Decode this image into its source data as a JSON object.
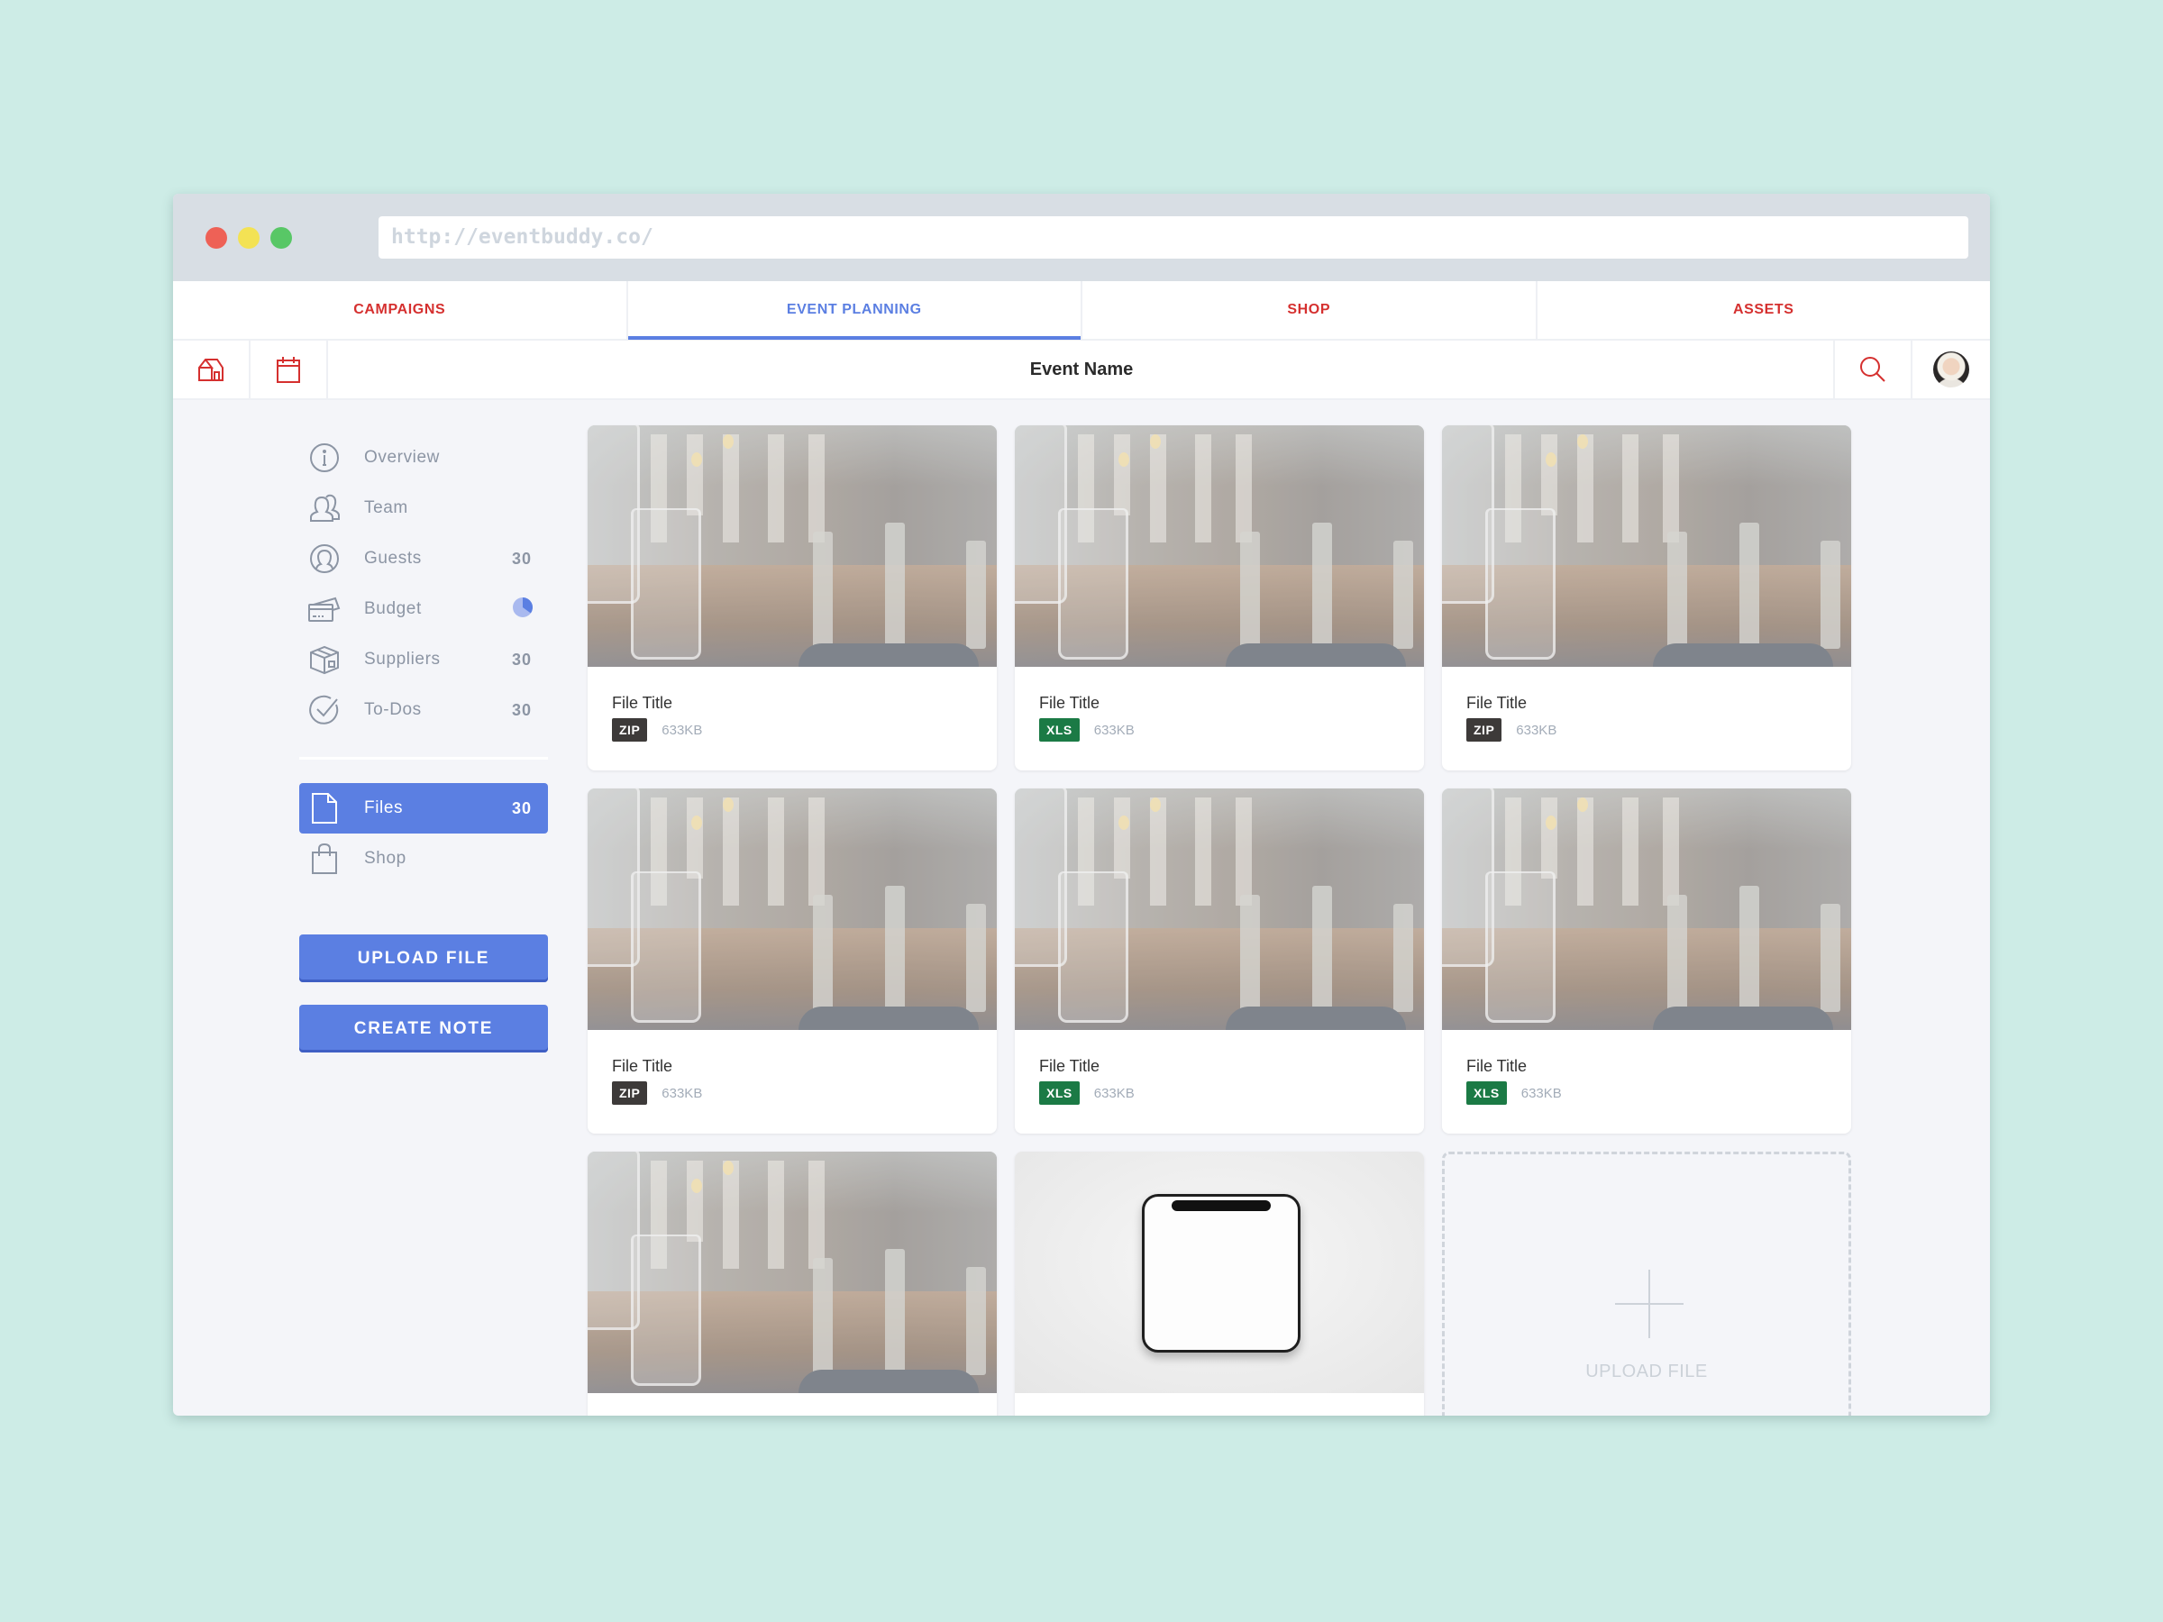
{
  "browser": {
    "url": "http://eventbuddy.co/"
  },
  "nav_tabs": [
    {
      "label": "CAMPAIGNS",
      "active": false
    },
    {
      "label": "EVENT PLANNING",
      "active": true
    },
    {
      "label": "SHOP",
      "active": false
    },
    {
      "label": "ASSETS",
      "active": false
    }
  ],
  "header": {
    "title": "Event Name",
    "icons": [
      "home-icon",
      "calendar-icon",
      "search-icon",
      "avatar"
    ]
  },
  "sidebar": {
    "items": [
      {
        "label": "Overview",
        "icon": "info-icon",
        "count": ""
      },
      {
        "label": "Team",
        "icon": "team-icon",
        "count": ""
      },
      {
        "label": "Guests",
        "icon": "guest-icon",
        "count": "30"
      },
      {
        "label": "Budget",
        "icon": "credit-card-icon",
        "count": "",
        "budget_progress": 0.35
      },
      {
        "label": "Suppliers",
        "icon": "box-icon",
        "count": "30"
      },
      {
        "label": "To-Dos",
        "icon": "check-circle-icon",
        "count": "30"
      }
    ],
    "secondary_items": [
      {
        "label": "Files",
        "icon": "file-icon",
        "count": "30",
        "active": true
      },
      {
        "label": "Shop",
        "icon": "shopping-bag-icon",
        "count": ""
      }
    ],
    "buttons": {
      "upload": "UPLOAD FILE",
      "create_note": "CREATE NOTE"
    }
  },
  "files": [
    {
      "title": "File Title",
      "type": "ZIP",
      "size": "633KB",
      "thumb": "restaurant-photo"
    },
    {
      "title": "File Title",
      "type": "XLS",
      "size": "633KB",
      "thumb": "restaurant-photo"
    },
    {
      "title": "File Title",
      "type": "ZIP",
      "size": "633KB",
      "thumb": "restaurant-photo"
    },
    {
      "title": "File Title",
      "type": "ZIP",
      "size": "633KB",
      "thumb": "restaurant-photo"
    },
    {
      "title": "File Title",
      "type": "XLS",
      "size": "633KB",
      "thumb": "restaurant-photo"
    },
    {
      "title": "File Title",
      "type": "XLS",
      "size": "633KB",
      "thumb": "restaurant-photo"
    },
    {
      "title": "",
      "type": "",
      "size": "",
      "thumb": "restaurant-photo"
    },
    {
      "title": "",
      "type": "",
      "size": "",
      "thumb": "device-photo"
    }
  ],
  "upload_tile": {
    "label": "UPLOAD FILE"
  },
  "colors": {
    "accent": "#5b7fe2",
    "nav_red": "#d5302f",
    "zip_badge": "#3d3a39",
    "xls_badge": "#1b7a45",
    "background": "#cdece6"
  }
}
